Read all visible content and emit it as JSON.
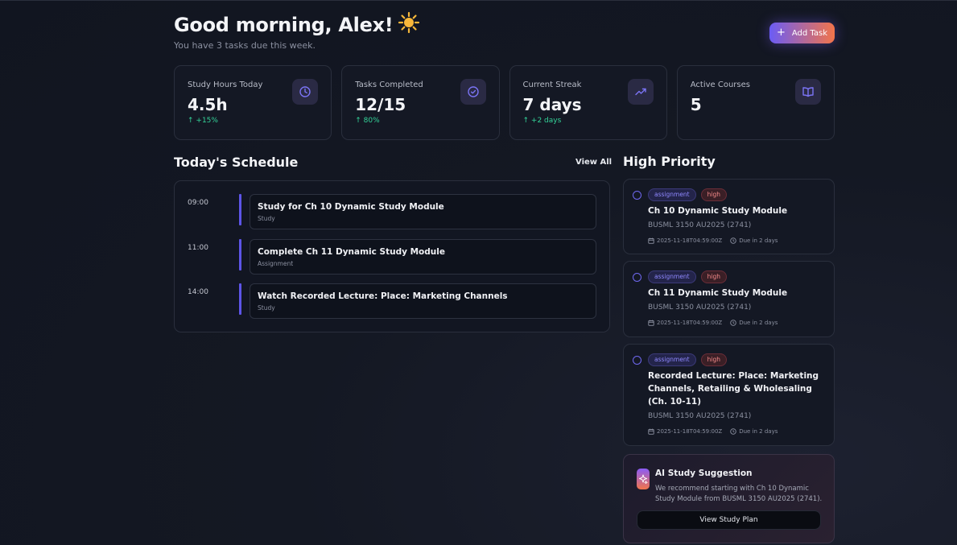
{
  "header": {
    "greeting": "Good morning, Alex!",
    "subtitle": "You have 3 tasks due this week.",
    "add_task_label": "Add Task"
  },
  "stats": [
    {
      "label": "Study Hours Today",
      "value": "4.5h",
      "delta": "↑ +15%",
      "icon": "clock-icon"
    },
    {
      "label": "Tasks Completed",
      "value": "12/15",
      "delta": "↑ 80%",
      "icon": "check-circle-icon"
    },
    {
      "label": "Current Streak",
      "value": "7 days",
      "delta": "↑ +2 days",
      "icon": "trending-up-icon"
    },
    {
      "label": "Active Courses",
      "value": "5",
      "delta": "",
      "icon": "book-open-icon"
    }
  ],
  "schedule": {
    "title": "Today's Schedule",
    "view_all": "View All",
    "items": [
      {
        "time": "09:00",
        "title": "Study for Ch 10 Dynamic Study Module",
        "type": "Study"
      },
      {
        "time": "11:00",
        "title": "Complete Ch 11 Dynamic Study Module",
        "type": "Assignment"
      },
      {
        "time": "14:00",
        "title": "Watch Recorded Lecture: Place: Marketing Channels",
        "type": "Study"
      }
    ]
  },
  "priority": {
    "title": "High Priority",
    "items": [
      {
        "type": "assignment",
        "priority": "high",
        "title": "Ch 10 Dynamic Study Module",
        "course": "BUSML 3150 AU2025 (2741)",
        "date": "2025-11-18T04:59:00Z",
        "due": "Due in 2 days"
      },
      {
        "type": "assignment",
        "priority": "high",
        "title": "Ch 11 Dynamic Study Module",
        "course": "BUSML 3150 AU2025 (2741)",
        "date": "2025-11-18T04:59:00Z",
        "due": "Due in 2 days"
      },
      {
        "type": "assignment",
        "priority": "high",
        "title": "Recorded Lecture: Place: Marketing Channels, Retailing & Wholesaling (Ch. 10-11)",
        "course": "BUSML 3150 AU2025 (2741)",
        "date": "2025-11-18T04:59:00Z",
        "due": "Due in 2 days"
      }
    ]
  },
  "ai_suggestion": {
    "title": "AI Study Suggestion",
    "text": "We recommend starting with Ch 10 Dynamic Study Module from BUSML 3150 AU2025 (2741).",
    "button": "View Study Plan"
  },
  "colors": {
    "accent": "#6b5cf5",
    "accent_warm": "#f2744a",
    "positive": "#34d399",
    "priority_high": "#f48a8a"
  }
}
